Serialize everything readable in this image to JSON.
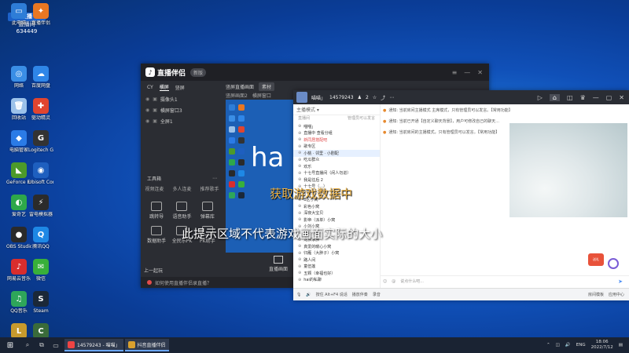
{
  "desktop": {
    "badge_top": "主播",
    "badge_mid": "直播间",
    "badge_num": "634449",
    "icons": [
      {
        "label": "此电脑",
        "color": "#2e7dd7",
        "glyph": "▭"
      },
      {
        "label": "直播伴侣",
        "color": "#e87722",
        "glyph": "✦"
      },
      {
        "label": "网络",
        "color": "#3a8ee6",
        "glyph": "◎"
      },
      {
        "label": "百度网盘",
        "color": "#2f86e8",
        "glyph": "☁"
      },
      {
        "label": "回收站",
        "color": "#9cc2ea",
        "glyph": "🗑"
      },
      {
        "label": "驱动精灵",
        "color": "#e0452f",
        "glyph": "✚"
      },
      {
        "label": "电脑管家",
        "color": "#2b7be6",
        "glyph": "◆"
      },
      {
        "label": "Logitech G HUB",
        "color": "#333",
        "glyph": "G"
      },
      {
        "label": "GeForce Experience",
        "color": "#4c9a2a",
        "glyph": "◣"
      },
      {
        "label": "Ubisoft Connect",
        "color": "#1e5fbf",
        "glyph": "◉"
      },
      {
        "label": "爱奇艺",
        "color": "#2ea84a",
        "glyph": "◐"
      },
      {
        "label": "雷电模拟器",
        "color": "#2b2b2b",
        "glyph": "⚡"
      },
      {
        "label": "OBS Studio",
        "color": "#2a2a2a",
        "glyph": "●"
      },
      {
        "label": "腾讯QQ",
        "color": "#1e88e5",
        "glyph": "Q"
      },
      {
        "label": "网易云音乐",
        "color": "#d92d2d",
        "glyph": "♪"
      },
      {
        "label": "微信",
        "color": "#38b03a",
        "glyph": "✉"
      },
      {
        "label": "QQ音乐",
        "color": "#2ea65a",
        "glyph": "♫"
      },
      {
        "label": "Steam",
        "color": "#1b2838",
        "glyph": "S"
      },
      {
        "label": "英雄联盟",
        "color": "#c79a2d",
        "glyph": "L"
      },
      {
        "label": "CSGO",
        "color": "#3a6b3a",
        "glyph": "C"
      }
    ]
  },
  "live": {
    "app_name": "直播伴侣",
    "version_pill": "新版",
    "tabs": [
      "CY",
      "横屏",
      "竖屏"
    ],
    "scenes": [
      {
        "label": "摄像头1"
      },
      {
        "label": "横屏窗口3"
      },
      {
        "label": "全屏1"
      }
    ],
    "source_header": "竖屏直播画面",
    "source_pill": "素材",
    "source_sub": [
      "竖屏画面2",
      "横屏窗口"
    ],
    "tools_header": "工具箱",
    "tools_more": "⋯",
    "tools_sub": [
      "视频连麦",
      "多人连麦",
      "推荐歌手"
    ],
    "tools_grid": [
      "跳转导",
      "语音助手",
      "弹幕库",
      "数据助手",
      "全民乐PK",
      "PK助手"
    ],
    "go_live_text": "上一起玩",
    "stream_btn": "直播画面",
    "footer_text": "如何使用直播伴侣录直播？",
    "preview_text": "ha"
  },
  "qq": {
    "room_title": "喵喵」",
    "room_id": "14579243",
    "count": "2",
    "toolbar": [
      "主播模式 ▾"
    ],
    "side_header_left": "直播间",
    "side_header_right": "管理员可以发言",
    "channels": [
      {
        "label": "喵喵」",
        "state": "normal"
      },
      {
        "label": "直播中 查看分组",
        "state": "normal"
      },
      {
        "label": "新同居搭配吧",
        "state": "red"
      },
      {
        "label": "歌专区",
        "state": "normal"
      },
      {
        "label": "小桃 · 邻里 · 小剧配",
        "state": "sel"
      },
      {
        "label": "吃瓜群众",
        "state": "normal"
      },
      {
        "label": "欢乐",
        "state": "normal"
      },
      {
        "label": "十七号直播间（闲人勿进）",
        "state": "normal"
      },
      {
        "label": "我是往后 2",
        "state": "normal"
      },
      {
        "label": "十七号（...）",
        "state": "normal"
      },
      {
        "label": "小窝",
        "state": "normal"
      },
      {
        "label": "B区小窝",
        "state": "normal"
      },
      {
        "label": "彩色小窝",
        "state": "normal"
      },
      {
        "label": "深夜大宝贝",
        "state": "normal"
      },
      {
        "label": "影帝（派单）小窝",
        "state": "normal"
      },
      {
        "label": "小刘小窝",
        "state": "normal"
      },
      {
        "label": "落叶小窝",
        "state": "normal"
      },
      {
        "label": "龙族家族",
        "state": "normal"
      },
      {
        "label": "真爱的暖心小窝",
        "state": "normal"
      },
      {
        "label": "归雁（大胖子）小窝",
        "state": "normal"
      },
      {
        "label": "路人间",
        "state": "normal"
      },
      {
        "label": "童伍莲",
        "state": "normal"
      },
      {
        "label": "五颗（幸福也好）",
        "state": "normal"
      },
      {
        "label": "hai的私聊",
        "state": "normal"
      }
    ],
    "messages": [
      "通知: 当前房间主播模式 主席模式，只有管理员可以发言。【常用功能】",
      "通知: 当前已开通【自定义聊天背景】，用户可修改自己的聊天...",
      "通知: 当前房间的主播模式，只有管理员可以发言。【常用功能】"
    ],
    "input_placeholder": "说点什么吧...",
    "send_icon": "➤",
    "bottom_left": [
      "按住 Alt+F4 说话",
      "播放伴奏",
      "录音"
    ],
    "bottom_right": [
      "房间模板",
      "应用中心"
    ],
    "gift_label": "送礼"
  },
  "overlay": {
    "loading_text": "获取游戏数据中",
    "hint_text": "此提示区域不代表游戏画面实际的大小"
  },
  "taskbar": {
    "start_icon": "⊞",
    "search_icon": "⌕",
    "task_view_icon": "⧉",
    "folder_icon": "▭",
    "app1": "14579243 - 喵喵」",
    "app2": "抖音直播伴侣",
    "lang": "ENG",
    "time": "18:06",
    "date": "2022/7/12"
  }
}
